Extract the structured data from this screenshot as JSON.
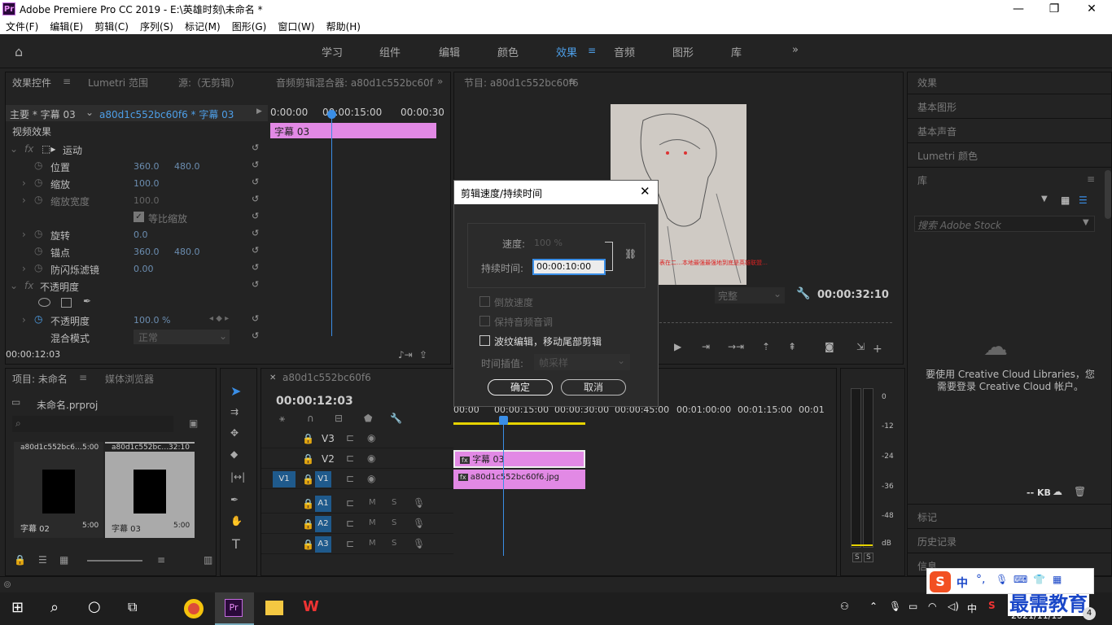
{
  "window": {
    "title": "Adobe Premiere Pro CC 2019 - E:\\英雄时刻\\未命名 *",
    "logo": "Pr",
    "minimize": "—",
    "maximize": "❐",
    "close": "✕"
  },
  "menu": [
    "文件(F)",
    "编辑(E)",
    "剪辑(C)",
    "序列(S)",
    "标记(M)",
    "图形(G)",
    "窗口(W)",
    "帮助(H)"
  ],
  "workspaces": {
    "items": [
      "学习",
      "组件",
      "编辑",
      "颜色",
      "效果",
      "音频",
      "图形",
      "库"
    ],
    "active": "效果",
    "more": "»"
  },
  "effect_controls": {
    "tabs": [
      "效果控件",
      "Lumetri 范围",
      "源:（无剪辑）",
      "音频剪辑混合器: a80d1c552bc60f"
    ],
    "master": "主要 * 字幕 03",
    "clip": "a80d1c552bc60f6 * 字幕 03",
    "ruler": [
      "0:00:00",
      "00:00:15:00",
      "00:00:30"
    ],
    "clip_bar": "字幕 03",
    "section": "视频效果",
    "motion": "运动",
    "position": {
      "label": "位置",
      "x": "360.0",
      "y": "480.0"
    },
    "scale": {
      "label": "缩放",
      "value": "100.0"
    },
    "scale_width": {
      "label": "缩放宽度",
      "value": "100.0"
    },
    "uniform": "等比缩放",
    "rotation": {
      "label": "旋转",
      "value": "0.0"
    },
    "anchor": {
      "label": "锚点",
      "x": "360.0",
      "y": "480.0"
    },
    "flicker": {
      "label": "防闪烁滤镜",
      "value": "0.00"
    },
    "opacity_section": "不透明度",
    "opacity": {
      "label": "不透明度",
      "value": "100.0 %"
    },
    "blend": {
      "label": "混合模式",
      "value": "正常"
    },
    "timecode": "00:00:12:03"
  },
  "program": {
    "title": "节目: a80d1c552bc60f6",
    "fit": "完整",
    "timecode": "00:00:32:10",
    "image_caption": "表在二…本地最强最强地到底是英雄联盟…"
  },
  "dialog": {
    "title": "剪辑速度/持续时间",
    "close": "✕",
    "speed_label": "速度:",
    "speed_value": "100 %",
    "duration_label": "持续时间:",
    "duration_value": "00:00:10:00",
    "reverse": "倒放速度",
    "keep_pitch": "保持音频音调",
    "ripple": "波纹编辑，移动尾部剪辑",
    "interp_label": "时间插值:",
    "interp_value": "帧采样",
    "ok": "确定",
    "cancel": "取消"
  },
  "right_panel": {
    "items": [
      "效果",
      "基本图形",
      "基本声音",
      "Lumetri 颜色",
      "库"
    ],
    "search_placeholder": "搜索 Adobe Stock",
    "cc_message": "要使用 Creative Cloud Libraries，您需要登录 Creative Cloud 帐户。",
    "kb": "-- KB",
    "bottom": [
      "标记",
      "历史记录",
      "信息"
    ]
  },
  "project": {
    "tabs": [
      "项目: 未命名",
      "媒体浏览器"
    ],
    "file": "未命名.prproj",
    "items": [
      {
        "name": "a80d1c552bc6…",
        "dur": "5:00",
        "label": "字幕 02",
        "ldur": "5:00"
      },
      {
        "name": "a80d1c552bc…",
        "dur": "32:10",
        "label": "字幕 03",
        "ldur": "5:00"
      }
    ]
  },
  "timeline": {
    "tab": "a80d1c552bc60f6",
    "timecode": "00:00:12:03",
    "ruler": [
      "00:00",
      "00:00:15:00",
      "00:00:30:00",
      "00:00:45:00",
      "00:01:00:00",
      "00:01:15:00",
      "00:01"
    ],
    "tracks": [
      "V3",
      "V2",
      "V1",
      "A1",
      "A2",
      "A3"
    ],
    "src_v1": "V1",
    "clip_v2": "字幕 03",
    "clip_v1": "a80d1c552bc60f6.jpg"
  },
  "meter": {
    "labels": [
      "0",
      "-12",
      "-24",
      "-36",
      "-48",
      "dB"
    ],
    "solo": [
      "S",
      "S"
    ]
  },
  "taskbar": {
    "date": "2021/11/15",
    "lang": "中",
    "ime": "中",
    "watermark": "最需教育",
    "notif": "4"
  }
}
